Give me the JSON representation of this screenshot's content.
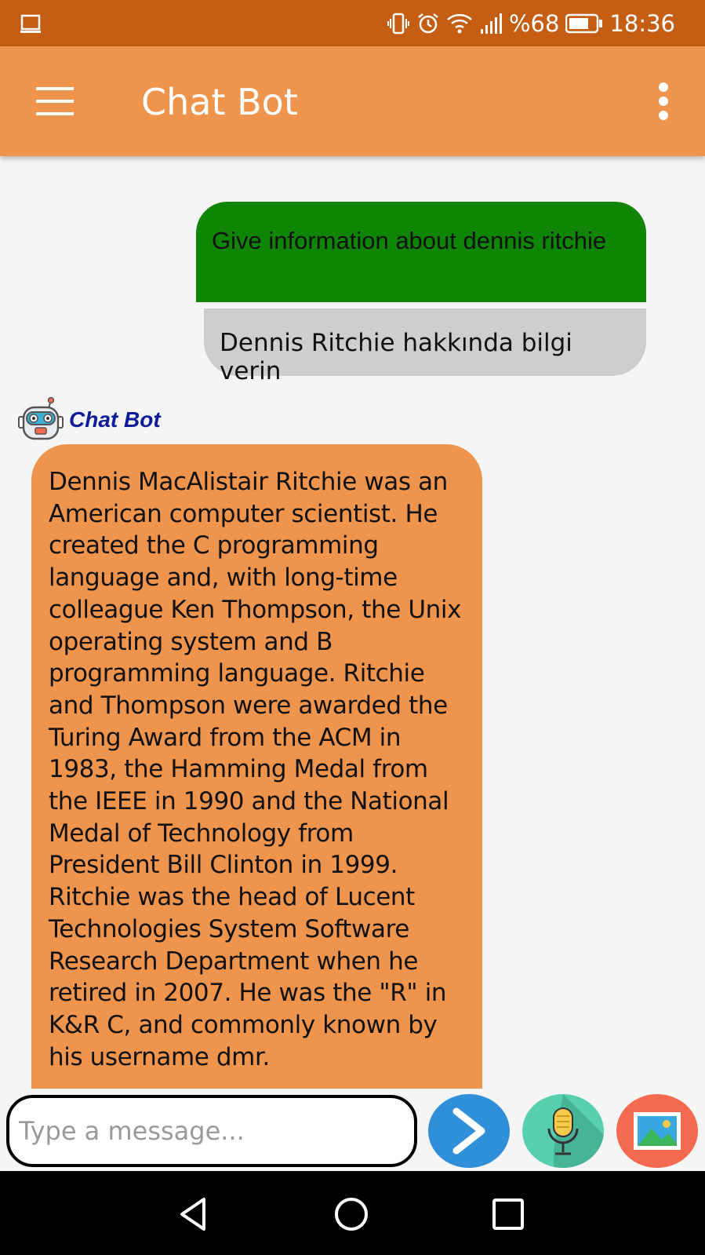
{
  "status_bar": {
    "battery_text": "%68",
    "time": "18:36",
    "icons": [
      "screen-cast-icon",
      "vibrate-icon",
      "alarm-icon",
      "wifi-icon",
      "signal-icon",
      "battery-icon"
    ]
  },
  "app_bar": {
    "title": "Chat Bot",
    "icons": [
      "menu-icon",
      "more-vert-icon"
    ]
  },
  "chat": {
    "user_message": "Give information about dennis ritchie",
    "user_translation": "Dennis Ritchie hakkında bilgi verin",
    "bot_name": "Chat Bot",
    "bot_message": "Dennis MacAlistair Ritchie was an American computer scientist. He created the C programming language and, with long-time colleague Ken Thompson, the Unix operating system and B programming language. Ritchie and Thompson were awarded the Turing Award from the ACM in 1983, the Hamming Medal from the IEEE in 1990 and the National Medal of Technology from President Bill Clinton in 1999. Ritchie was the head of Lucent Technologies System Software Research Department when he retired in 2007. He was the \"R\" in K&R C, and commonly known by his username dmr."
  },
  "composer": {
    "placeholder": "Type a message...",
    "value": ""
  },
  "colors": {
    "status_bar": "#c55e12",
    "app_bar": "#ef944c",
    "user_bubble": "#0e8504",
    "translation_bubble": "#cfcdcd",
    "bot_bubble": "#ef944c",
    "bot_name": "#0e1c99",
    "send_button": "#2f8fd8",
    "mic_button": "#57d0ae",
    "image_button": "#f36a50"
  }
}
